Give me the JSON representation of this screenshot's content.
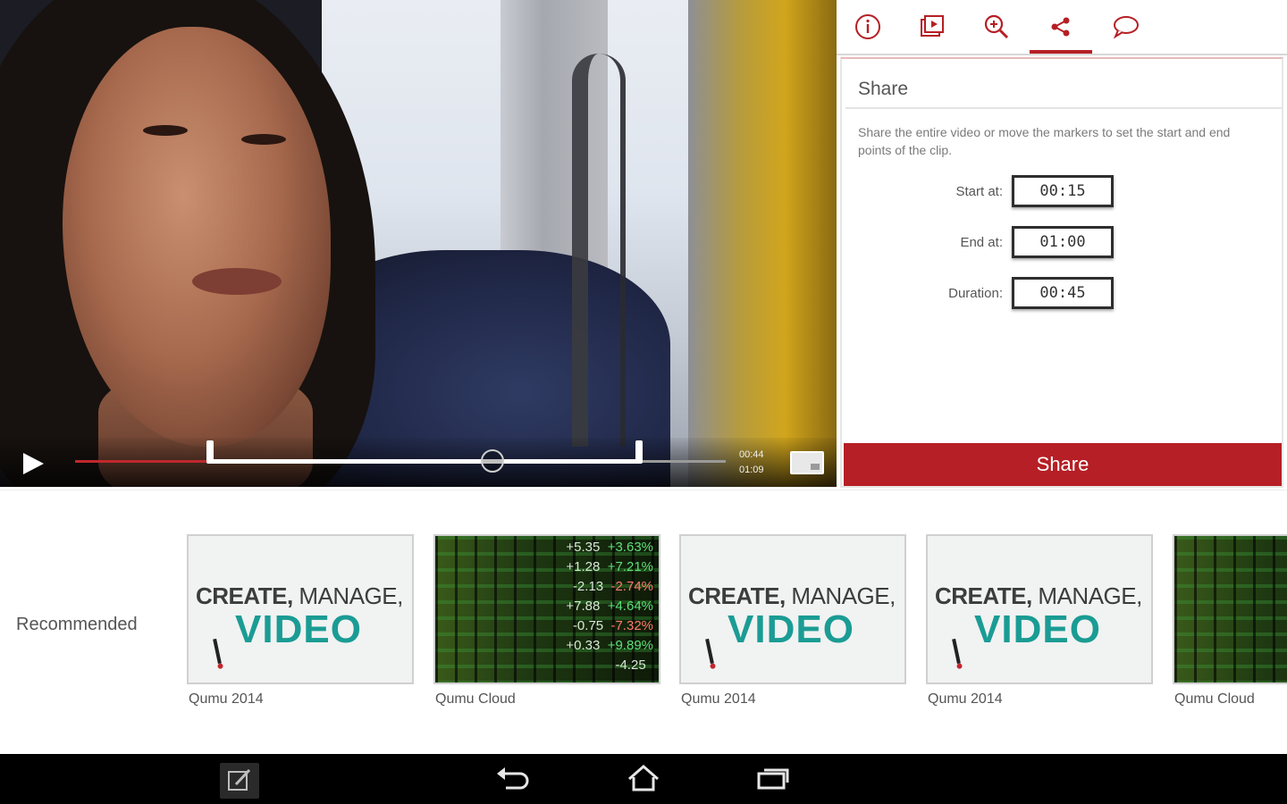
{
  "player": {
    "current_time": "00:44",
    "total_time": "01:09",
    "progress_fraction": 0.21,
    "clip_start_fraction": 0.22,
    "clip_end_fraction": 0.87
  },
  "panel": {
    "tabs": [
      {
        "icon": "info-icon",
        "active": false
      },
      {
        "icon": "playlist-icon",
        "active": false
      },
      {
        "icon": "zoom-in-icon",
        "active": false
      },
      {
        "icon": "share-icon",
        "active": true
      },
      {
        "icon": "comment-icon",
        "active": false
      }
    ],
    "share": {
      "title": "Share",
      "description": "Share the entire video or move the markers to set the start and end points of the clip.",
      "start_label": "Start at:",
      "start_value": "00:15",
      "end_label": "End at:",
      "end_value": "01:00",
      "duration_label": "Duration:",
      "duration_value": "00:45",
      "button_label": "Share"
    }
  },
  "recommended": {
    "label": "Recommended",
    "items": [
      {
        "caption": "Qumu 2014",
        "thumb": "create"
      },
      {
        "caption": "Qumu Cloud",
        "thumb": "stocks"
      },
      {
        "caption": "Qumu 2014",
        "thumb": "create"
      },
      {
        "caption": "Qumu 2014",
        "thumb": "create"
      },
      {
        "caption": "Qumu Cloud",
        "thumb": "stocks"
      }
    ],
    "create_thumb": {
      "bold": "CREATE,",
      "rest": " MANAGE,",
      "big": "VIDEO"
    },
    "stocks_thumb": {
      "rows": [
        [
          "+5.35",
          "+3.63%"
        ],
        [
          "+1.28",
          "+7.21%"
        ],
        [
          "-2.13",
          "-2.74%"
        ],
        [
          "+7.88",
          "+4.64%"
        ],
        [
          "-0.75",
          "-7.32%"
        ],
        [
          "+0.33",
          "+9.89%"
        ],
        [
          "-4.25",
          ""
        ]
      ]
    }
  },
  "navbar": {
    "buttons": [
      "compose-icon",
      "back-icon",
      "home-icon",
      "recent-apps-icon"
    ]
  },
  "colors": {
    "accent": "#b51f25",
    "teal": "#1a9c94"
  }
}
